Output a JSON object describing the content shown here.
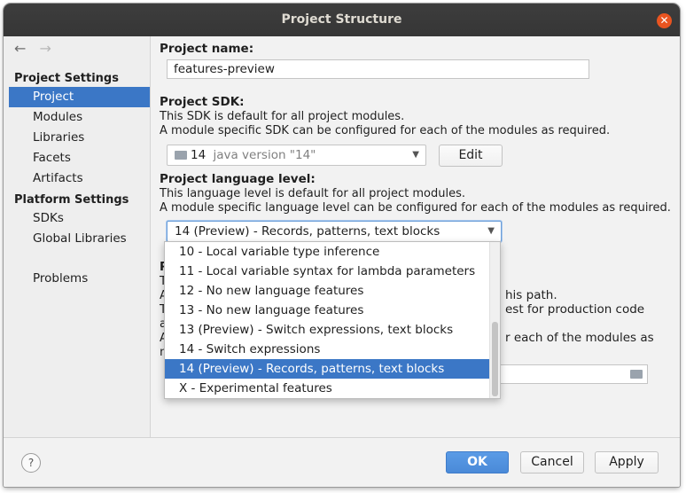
{
  "window": {
    "title": "Project Structure"
  },
  "sidebar": {
    "back": "←",
    "forward": "→",
    "project_settings": "Project Settings",
    "project_items": [
      "Project",
      "Modules",
      "Libraries",
      "Facets",
      "Artifacts"
    ],
    "platform_settings": "Platform Settings",
    "platform_items": [
      "SDKs",
      "Global Libraries"
    ],
    "problems": "Problems",
    "selected": "Project"
  },
  "project_name": {
    "label": "Project name:",
    "value": "features-preview"
  },
  "project_sdk": {
    "label": "Project SDK:",
    "desc1": "This SDK is default for all project modules.",
    "desc2": "A module specific SDK can be configured for each of the modules as required.",
    "sdk_name": "14",
    "sdk_version": "java version \"14\"",
    "edit_button": "Edit"
  },
  "language_level": {
    "label": "Project language level:",
    "desc1": "This language level is default for all project modules.",
    "desc2": "A module specific language level can be configured for each of the modules as required.",
    "selected": "14 (Preview) - Records, patterns, text blocks",
    "options": [
      "10 - Local variable type inference",
      "11 - Local variable syntax for lambda parameters",
      "12 - No new language features",
      "13 - No new language features",
      "13 (Preview) - Switch expressions, text blocks",
      "14 - Switch expressions",
      "14 (Preview) - Records, patterns, text blocks",
      "X - Experimental features"
    ]
  },
  "obscured": {
    "label_start": "P",
    "line1_start": "T",
    "line2_start": "A",
    "line2_end": "his path.",
    "line3_start": "T",
    "line3_end": "est for production code",
    "line4_start": "a",
    "line5_start": "A",
    "line5_end": "r each of the modules as",
    "line6_start": "n"
  },
  "footer": {
    "help": "?",
    "ok": "OK",
    "cancel": "Cancel",
    "apply": "Apply"
  }
}
